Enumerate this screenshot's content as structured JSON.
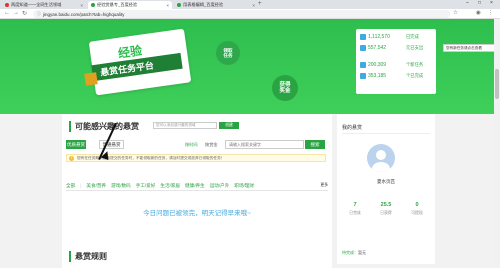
{
  "browser": {
    "tabs": [
      {
        "title": "两度知道——全网生活领域",
        "active": false
      },
      {
        "title": "经验赏悬专_百度经验",
        "active": true
      },
      {
        "title": "用表格编辑_百度经验",
        "active": false
      }
    ],
    "url": "jingyan.baidu.com/patch?tab=highquality"
  },
  "banner": {
    "title_line1": "经验",
    "title_line2": "悬赏任务平台",
    "badge1": "领取\n任务",
    "badge2": "获得\n奖金",
    "stats": [
      {
        "value": "1,112,570",
        "label": "已完成"
      },
      {
        "value": "557,542",
        "label": "元已支出"
      },
      {
        "value": "200,309",
        "label": "个新任务"
      },
      {
        "value": "353,185",
        "label": "个已完成"
      }
    ],
    "popup_text": "您有新任务请点击查看"
  },
  "main": {
    "section_title": "可能感兴趣的悬赏",
    "hint_placeholder": "您可以添加感兴趣的领域",
    "hint_button": "创建",
    "tab_primary": "优质悬赏",
    "tab_secondary": "普通悬赏",
    "sort_time": "按时间",
    "sort_reward": "按赏金",
    "search_placeholder": "请输入搜索关键字",
    "search_button": "搜索",
    "notice": "您有在任务期间还未提交的任务时，不能领取新的任务，请及时提交或放弃已领取的任务！",
    "categories": [
      "全部",
      "美食/营养",
      "游戏/数码",
      "手工/爱好",
      "生活/家居",
      "健康/养生",
      "运动/户外",
      "职场/理财"
    ],
    "more_label": "更多",
    "empty_message": "今日问题已被领完，明天记得早来哦~"
  },
  "sidebar": {
    "title": "我的悬赏",
    "username": "夏水页匹",
    "stats": [
      {
        "value": "7",
        "label": "已完成"
      },
      {
        "value": "25.5",
        "label": "已获得"
      },
      {
        "value": "0",
        "label": "可提现"
      }
    ],
    "pending_label": "待完成：",
    "pending_value": "暂无"
  },
  "rules": {
    "title": "悬赏规则"
  },
  "colors": {
    "accent": "#2aa443",
    "banner": "#3fcf5a",
    "link": "#3fa9e0"
  }
}
